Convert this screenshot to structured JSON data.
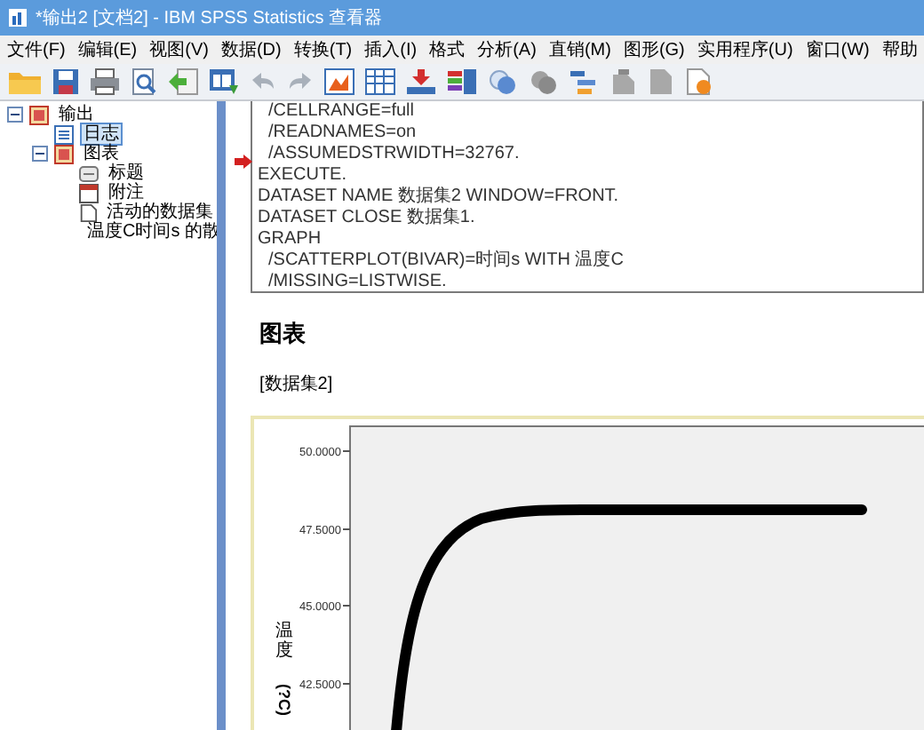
{
  "window": {
    "title": "*输出2 [文档2] - IBM SPSS Statistics 查看器"
  },
  "menu": [
    "文件(F)",
    "编辑(E)",
    "视图(V)",
    "数据(D)",
    "转换(T)",
    "插入(I)",
    "格式",
    "分析(A)",
    "直销(M)",
    "图形(G)",
    "实用程序(U)",
    "窗口(W)",
    "帮助"
  ],
  "tree": [
    {
      "label": "输出",
      "kind": "folder",
      "expanded": true,
      "selected": false,
      "children": [
        {
          "label": "日志",
          "kind": "log",
          "selected": true
        },
        {
          "label": "图表",
          "kind": "folder",
          "expanded": true,
          "selected": false,
          "children": [
            {
              "label": "标题",
              "kind": "title",
              "selected": false
            },
            {
              "label": "附注",
              "kind": "note",
              "selected": false
            },
            {
              "label": "活动的数据集",
              "kind": "dataset",
              "selected": false
            },
            {
              "label": "温度C时间s 的散",
              "kind": "chart",
              "selected": false
            }
          ]
        }
      ]
    }
  ],
  "syntax": [
    {
      "text": "/CELLRANGE=full",
      "indent": true
    },
    {
      "text": "/READNAMES=on",
      "indent": true
    },
    {
      "text": "/ASSUMEDSTRWIDTH=32767.",
      "indent": true
    },
    {
      "text": "EXECUTE.",
      "indent": false
    },
    {
      "text": "DATASET NAME 数据集2 WINDOW=FRONT.",
      "indent": false
    },
    {
      "text": "DATASET CLOSE 数据集1.",
      "indent": false
    },
    {
      "text": "GRAPH",
      "indent": false
    },
    {
      "text": "/SCATTERPLOT(BIVAR)=时间s WITH 温度C",
      "indent": true
    },
    {
      "text": "/MISSING=LISTWISE.",
      "indent": true
    }
  ],
  "heading": "图表",
  "dataset_label": "[数据集2]",
  "chart": {
    "y_tick_labels": [
      "50.0000",
      "47.5000",
      "45.0000",
      "42.5000"
    ],
    "ylabel_chars": "温度",
    "ylabel_unit": "(?C)"
  }
}
